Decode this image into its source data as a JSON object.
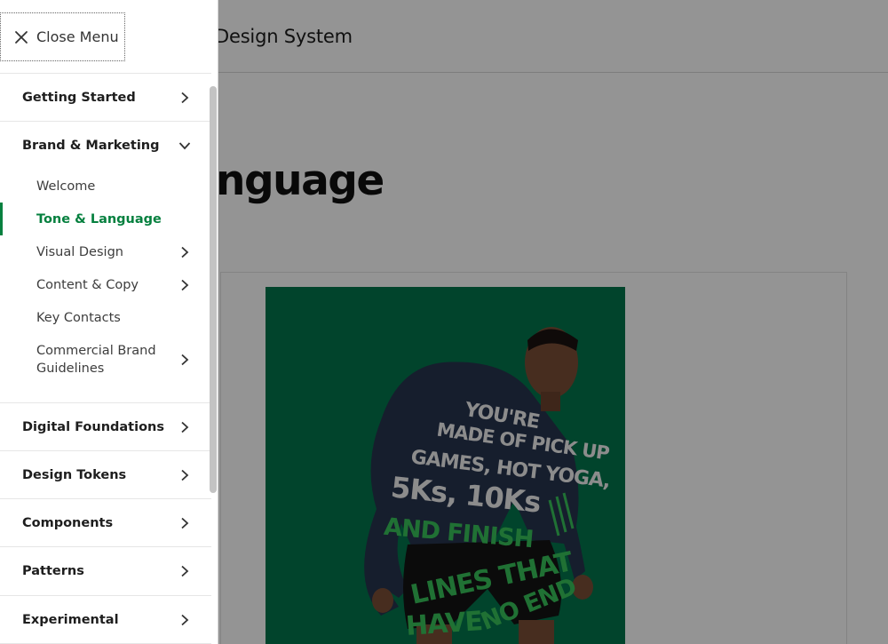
{
  "header": {
    "site_title": "Design System"
  },
  "main": {
    "page_heading": "Tone & Language",
    "visible_heading_fragment": "nguage"
  },
  "poster": {
    "lines": [
      "YOU'RE",
      "MADE OF PICK UP",
      "GAMES, HOT YOGA,",
      "5Ks, 10Ks",
      "AND FINISH",
      "LINES THAT",
      "HAVE",
      "NO END"
    ],
    "background_color": "#02764c",
    "highlight_color": "#38c35a"
  },
  "menu": {
    "close_label": "Close Menu",
    "items": [
      {
        "label": "Getting Started",
        "icon": "chevron-right-icon"
      },
      {
        "label": "Brand & Marketing",
        "icon": "chevron-down-icon",
        "expanded": true,
        "children": [
          {
            "label": "Welcome"
          },
          {
            "label": "Tone & Language",
            "active": true
          },
          {
            "label": "Visual Design",
            "icon": "chevron-right-icon"
          },
          {
            "label": "Content & Copy",
            "icon": "chevron-right-icon"
          },
          {
            "label": "Key Contacts"
          },
          {
            "label": "Commercial Brand Guidelines",
            "icon": "chevron-right-icon"
          }
        ]
      },
      {
        "label": "Digital Foundations",
        "icon": "chevron-right-icon"
      },
      {
        "label": "Design Tokens",
        "icon": "chevron-right-icon"
      },
      {
        "label": "Components",
        "icon": "chevron-right-icon"
      },
      {
        "label": "Patterns",
        "icon": "chevron-right-icon"
      },
      {
        "label": "Experimental",
        "icon": "chevron-right-icon"
      }
    ]
  },
  "colors": {
    "active": "#06803f",
    "scrim": "rgba(0,0,0,0.42)"
  }
}
